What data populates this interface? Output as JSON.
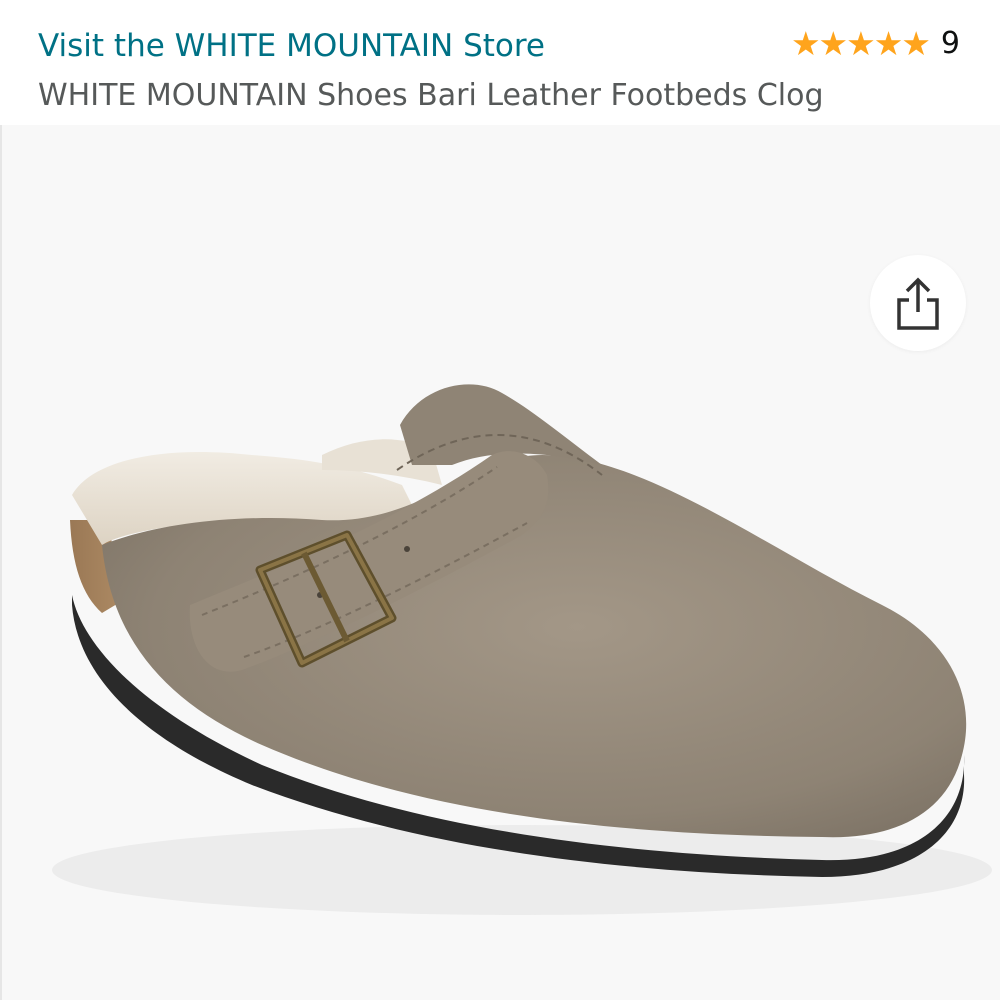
{
  "header": {
    "store_link": "Visit the WHITE MOUNTAIN Store",
    "product_title": "WHITE MOUNTAIN Shoes Bari Leather Footbeds Clog",
    "rating": {
      "stars": 5,
      "count": "9"
    }
  },
  "colors": {
    "link": "#007185",
    "star": "#FFA41C",
    "title": "#565959"
  },
  "product_image": {
    "alt": "WHITE MOUNTAIN Bari suede clog with shearling lining and buckle strap"
  },
  "icons": {
    "share": "share-icon",
    "star": "star-icon"
  }
}
